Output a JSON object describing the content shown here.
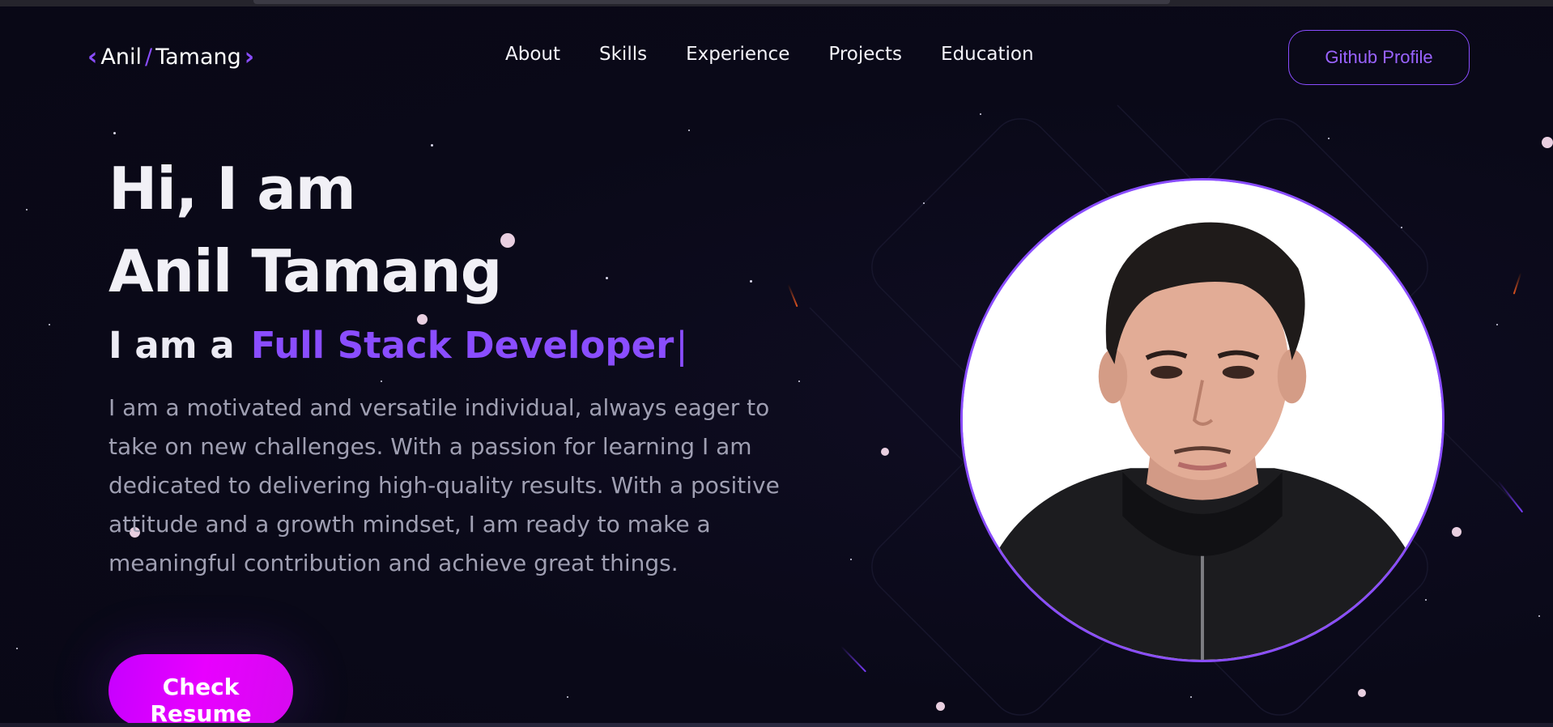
{
  "nav": {
    "logo": {
      "first": "Anil",
      "last": "Tamang",
      "left_icon": "chevron-left-icon",
      "right_icon": "chevron-right-icon"
    },
    "links": [
      {
        "label": "About"
      },
      {
        "label": "Skills"
      },
      {
        "label": "Experience"
      },
      {
        "label": "Projects"
      },
      {
        "label": "Education"
      }
    ],
    "cta_label": "Github Profile"
  },
  "hero": {
    "greeting": "Hi, I am",
    "name": "Anil Tamang",
    "role_prefix": "I am a",
    "role": "Full Stack Developer",
    "cursor": "|",
    "bio": "I am a motivated and versatile individual, always eager to take on new challenges. With a passion for learning I am dedicated to delivering high-quality results. With a positive attitude and a growth mindset, I am ready to make a meaningful contribution and achieve great things.",
    "resume_label": "Check Resume",
    "photo_icon": "profile-photo"
  },
  "colors": {
    "background": "#0b0a18",
    "accent": "#8a4dff",
    "resume_gradient_start": "#c600ff",
    "resume_gradient_end": "#e800ff",
    "text_primary": "#f1f0f6",
    "text_muted": "#9f9fb2"
  }
}
